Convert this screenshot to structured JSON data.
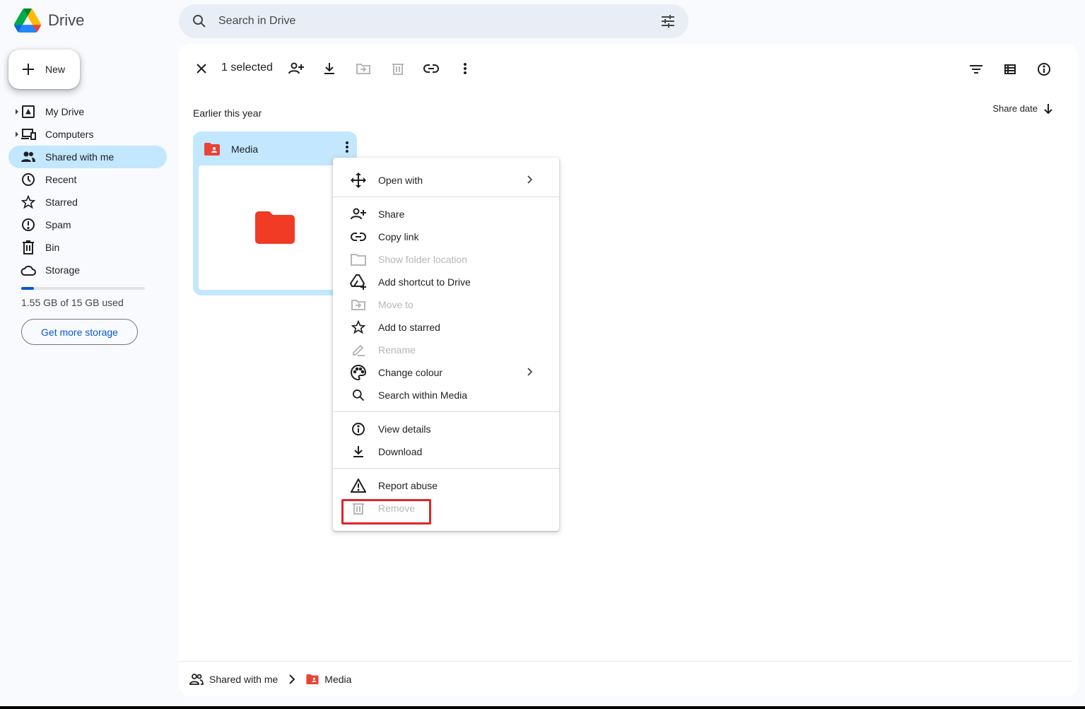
{
  "app": {
    "name": "Drive",
    "brand_colors": [
      "#0066da",
      "#00ac47",
      "#ffba00",
      "#ea4335"
    ]
  },
  "search": {
    "placeholder": "Search in Drive"
  },
  "sidebar": {
    "new_label": "New",
    "items": [
      {
        "label": "My Drive",
        "icon": "my-drive-icon",
        "expandable": true
      },
      {
        "label": "Computers",
        "icon": "computers-icon",
        "expandable": true
      },
      {
        "label": "Shared with me",
        "icon": "people-icon",
        "active": true
      },
      {
        "label": "Recent",
        "icon": "clock-icon"
      },
      {
        "label": "Starred",
        "icon": "star-icon"
      },
      {
        "label": "Spam",
        "icon": "spam-icon"
      },
      {
        "label": "Bin",
        "icon": "trash-icon"
      },
      {
        "label": "Storage",
        "icon": "cloud-icon"
      }
    ],
    "storage": {
      "used_text": "1.55 GB of 15 GB used",
      "used_fraction": 0.103,
      "button_label": "Get more storage"
    }
  },
  "toolbar": {
    "selected_text": "1 selected"
  },
  "main": {
    "section_title": "Earlier this year",
    "sort_label": "Share date",
    "folder": {
      "name": "Media",
      "color": "#ea4335"
    }
  },
  "breadcrumb": {
    "root": "Shared with me",
    "current": "Media"
  },
  "context_menu": {
    "items": [
      {
        "label": "Open with",
        "icon": "open-with-icon",
        "submenu": true
      },
      {
        "label": "Share",
        "icon": "share-icon"
      },
      {
        "label": "Copy link",
        "icon": "link-icon"
      },
      {
        "label": "Show folder location",
        "icon": "folder-outline-icon",
        "disabled": true
      },
      {
        "label": "Add shortcut to Drive",
        "icon": "add-shortcut-icon"
      },
      {
        "label": "Move to",
        "icon": "move-icon",
        "disabled": true
      },
      {
        "label": "Add to starred",
        "icon": "star-icon"
      },
      {
        "label": "Rename",
        "icon": "rename-icon",
        "disabled": true
      },
      {
        "label": "Change colour",
        "icon": "palette-icon",
        "submenu": true
      },
      {
        "label": "Search within Media",
        "icon": "search-icon"
      },
      {
        "label": "View details",
        "icon": "info-icon"
      },
      {
        "label": "Download",
        "icon": "download-icon"
      },
      {
        "label": "Report abuse",
        "icon": "warning-icon"
      },
      {
        "label": "Remove",
        "icon": "trash-icon",
        "disabled": true
      }
    ]
  },
  "annotation": {
    "color": "#e0242b",
    "target": "Remove"
  }
}
